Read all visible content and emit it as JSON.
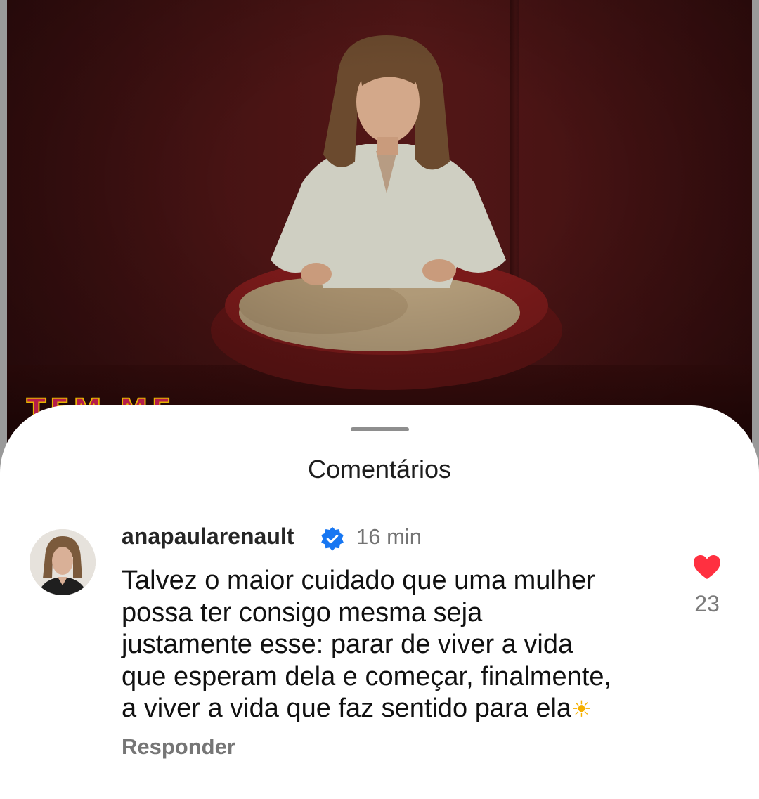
{
  "video": {
    "overlay_text": "TEM ME"
  },
  "comments_panel": {
    "title": "Comentários"
  },
  "comment": {
    "username": "anapaularenault",
    "verified": true,
    "time": "16 min",
    "text_lines": [
      "Talvez o maior cuidado que uma mulher",
      "possa ter consigo mesma seja",
      "justamente esse: parar de viver a vida",
      "que esperam dela e começar, finalmente,",
      "a viver a vida que faz sentido para ela"
    ],
    "emoji": "☀",
    "reply_label": "Responder",
    "like_count": "23"
  },
  "icons": {
    "verified": "verified-badge-icon",
    "like": "heart-icon"
  },
  "colors": {
    "verified_blue": "#1877f2",
    "like_red": "#ff3040",
    "video_background": "#4a1414"
  }
}
